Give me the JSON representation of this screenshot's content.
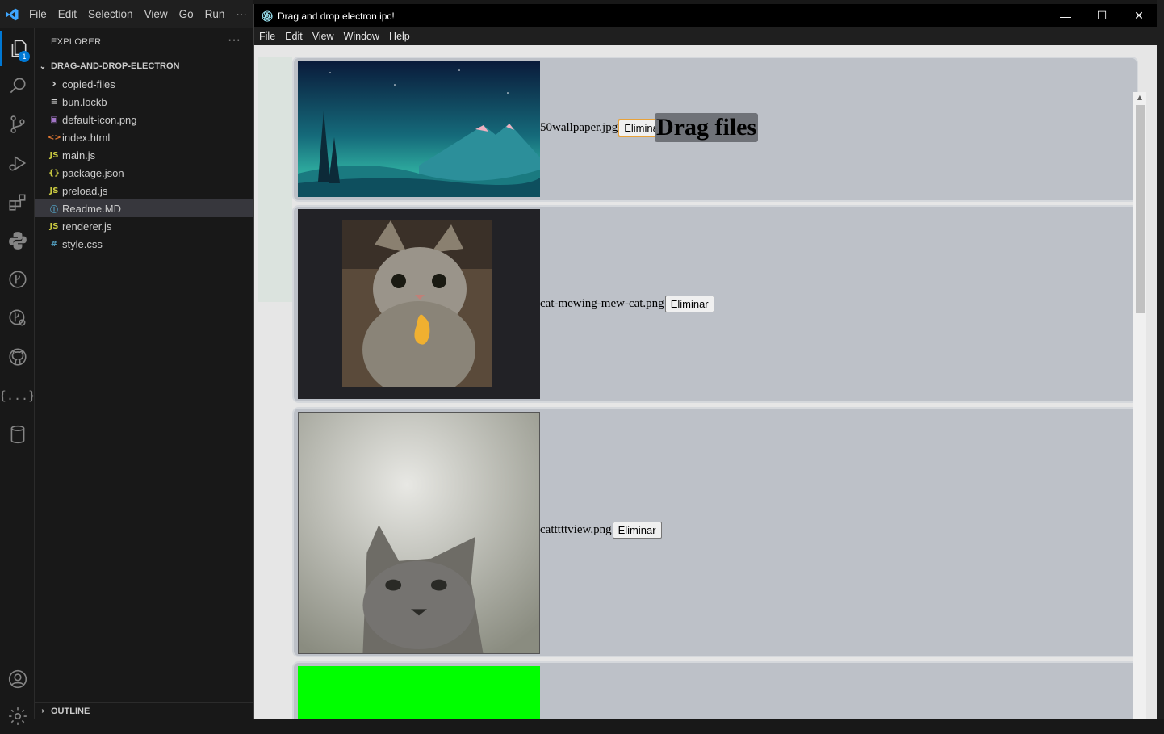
{
  "vscode": {
    "menu": [
      "File",
      "Edit",
      "Selection",
      "View",
      "Go",
      "Run"
    ],
    "menu_more": "···",
    "explorer_badge": "1",
    "activity_icons": [
      "explorer-icon",
      "search-icon",
      "source-control-icon",
      "run-debug-icon",
      "extensions-icon",
      "python-icon",
      "git-graph-icon",
      "remote-explorer-icon",
      "github-icon",
      "json-icon",
      "database-icon",
      "account-icon",
      "settings-icon"
    ],
    "sidebar": {
      "title": "EXPLORER",
      "more": "···",
      "folder": "DRAG-AND-DROP-ELECTRON",
      "items": [
        {
          "icon": "›",
          "label": "copied-files",
          "color": "#cccccc",
          "type": "folder"
        },
        {
          "icon": "≡",
          "label": "bun.lockb",
          "color": "#cccccc",
          "type": "file"
        },
        {
          "icon": "▣",
          "label": "default-icon.png",
          "color": "#a074c4",
          "type": "file"
        },
        {
          "icon": "<>",
          "label": "index.html",
          "color": "#e37933",
          "type": "file"
        },
        {
          "icon": "JS",
          "label": "main.js",
          "color": "#cbcb41",
          "type": "file"
        },
        {
          "icon": "{}",
          "label": "package.json",
          "color": "#cbcb41",
          "type": "file"
        },
        {
          "icon": "JS",
          "label": "preload.js",
          "color": "#cbcb41",
          "type": "file"
        },
        {
          "icon": "ⓘ",
          "label": "Readme.MD",
          "color": "#519aba",
          "type": "file",
          "selected": true
        },
        {
          "icon": "JS",
          "label": "renderer.js",
          "color": "#cbcb41",
          "type": "file"
        },
        {
          "icon": "#",
          "label": "style.css",
          "color": "#519aba",
          "type": "file"
        }
      ],
      "outline": "OUTLINE"
    }
  },
  "electron": {
    "title": "Drag and drop electron ipc!",
    "menu": [
      "File",
      "Edit",
      "View",
      "Window",
      "Help"
    ],
    "heading": "Drag files",
    "files": [
      {
        "name": "50wallpaper.jpg",
        "button": "Eliminar"
      },
      {
        "name": "cat-mewing-mew-cat.png",
        "button": "Eliminar"
      },
      {
        "name": "catttttview.png",
        "button": "Eliminar"
      },
      {
        "name": "",
        "button": ""
      }
    ],
    "controls": {
      "minimize": "—",
      "maximize": "☐",
      "close": "✕"
    }
  }
}
